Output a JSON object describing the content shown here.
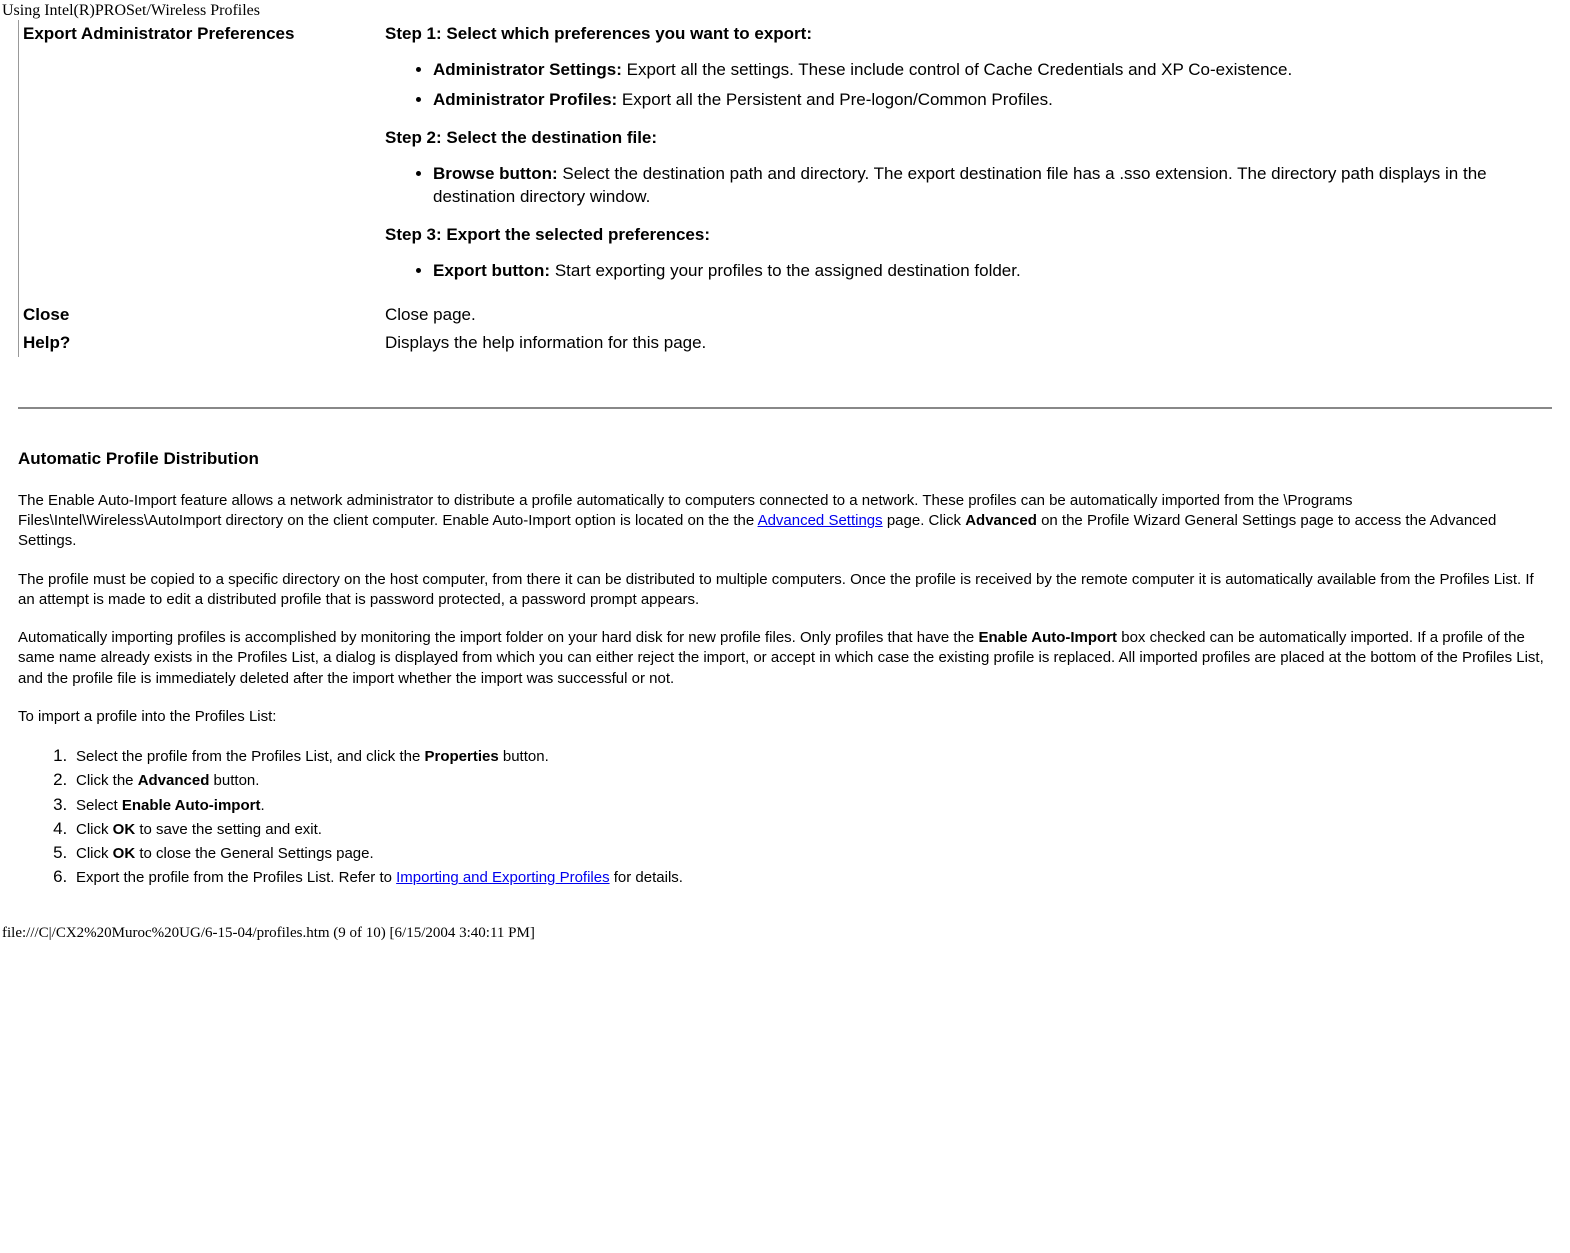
{
  "header": "Using Intel(R)PROSet/Wireless Profiles",
  "table": {
    "row1": {
      "term": "Export Administrator Preferences",
      "step1_title": "Step 1: Select which preferences you want to export:",
      "step1_bullets": [
        {
          "bold": "Administrator Settings:",
          "text": " Export all the settings. These include control of Cache Credentials and XP Co-existence."
        },
        {
          "bold": "Administrator Profiles:",
          "text": " Export all the Persistent and Pre-logon/Common Profiles."
        }
      ],
      "step2_title": "Step 2: Select the destination file:",
      "step2_bullets": [
        {
          "bold": "Browse button:",
          "text": " Select the destination path and directory. The export destination file has a .sso extension. The directory path displays in the destination directory window."
        }
      ],
      "step3_title": "Step 3: Export the selected preferences:",
      "step3_bullets": [
        {
          "bold": "Export button:",
          "text": " Start exporting your profiles to the assigned destination folder."
        }
      ]
    },
    "row2": {
      "term": "Close",
      "desc": "Close page."
    },
    "row3": {
      "term": "Help?",
      "desc": "Displays the help information for this page."
    }
  },
  "section": {
    "title": "Automatic Profile Distribution",
    "p1_a": "The Enable Auto-Import feature allows a network administrator to distribute a profile automatically to computers connected to a network. These profiles can be automatically imported from the \\Programs Files\\Intel\\Wireless\\AutoImport directory on the client computer. Enable Auto-Import option is located on the the ",
    "p1_link": "Advanced Settings",
    "p1_b": " page. Click ",
    "p1_bold": "Advanced",
    "p1_c": " on the Profile Wizard General Settings page to access the Advanced Settings.",
    "p2": "The profile must be copied to a specific directory on the host computer, from there it can be distributed to multiple computers. Once the profile is received by the remote computer it is automatically available from the Profiles List. If an attempt is made to edit a distributed profile that is password protected, a password prompt appears.",
    "p3_a": "Automatically importing profiles is accomplished by monitoring the import folder on your hard disk for new profile files. Only profiles that have the ",
    "p3_bold": "Enable Auto-Import",
    "p3_b": " box checked can be automatically imported. If a profile of the same name already exists in the Profiles List, a dialog is displayed from which you can either reject the import, or accept in which case the existing profile is replaced. All imported profiles are placed at the bottom of the Profiles List, and the profile file is immediately deleted after the import whether the import was successful or not.",
    "p4": "To import a profile into the Profiles List:",
    "steps": {
      "s1_a": "Select the profile from the Profiles List, and click the ",
      "s1_bold": "Properties",
      "s1_b": " button.",
      "s2_a": "Click the ",
      "s2_bold": "Advanced",
      "s2_b": " button.",
      "s3_a": "Select ",
      "s3_bold": "Enable Auto-import",
      "s3_b": ".",
      "s4_a": "Click ",
      "s4_bold": "OK",
      "s4_b": " to save the setting and exit.",
      "s5_a": "Click ",
      "s5_bold": "OK",
      "s5_b": " to close the General Settings page.",
      "s6_a": "Export the profile from the Profiles List. Refer to ",
      "s6_link": "Importing and Exporting Profiles",
      "s6_b": " for details."
    }
  },
  "footer": "file:///C|/CX2%20Muroc%20UG/6-15-04/profiles.htm (9 of 10) [6/15/2004 3:40:11 PM]"
}
